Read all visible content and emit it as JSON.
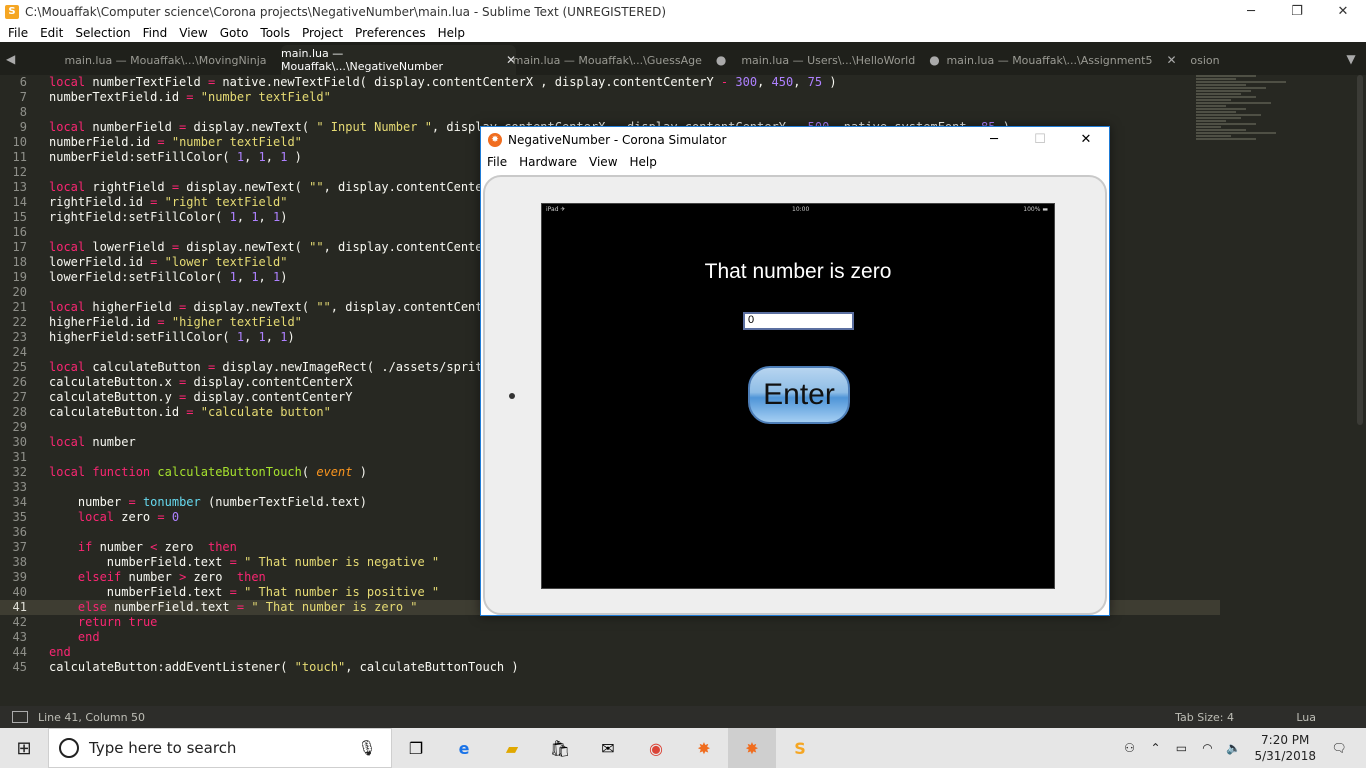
{
  "window": {
    "title": "C:\\Mouaffak\\Computer science\\Corona projects\\NegativeNumber\\main.lua - Sublime Text (UNREGISTERED)"
  },
  "menu": [
    "File",
    "Edit",
    "Selection",
    "Find",
    "View",
    "Goto",
    "Tools",
    "Project",
    "Preferences",
    "Help"
  ],
  "tabs": [
    {
      "label": "main.lua — Mouaffak\\...\\MovingNinja",
      "close": "✕",
      "active": false
    },
    {
      "label": "main.lua — Mouaffak\\...\\NegativeNumber",
      "close": "✕",
      "active": true
    },
    {
      "label": "main.lua — Mouaffak\\...\\GuessAge",
      "close": "●",
      "active": false
    },
    {
      "label": "main.lua — Users\\...\\HelloWorld",
      "close": "●",
      "active": false
    },
    {
      "label": "main.lua — Mouaffak\\...\\Assignment5",
      "close": "✕",
      "active": false
    },
    {
      "label": "osion",
      "close": "",
      "active": false
    }
  ],
  "editor": {
    "current_line": 41,
    "lines": [
      {
        "n": "6",
        "code": "local numberTextField = native.newTextField( display.contentCenterX , display.contentCenterY - 300, 450, 75 )"
      },
      {
        "n": "7",
        "code": "numberTextField.id = \"number textField\""
      },
      {
        "n": "8",
        "code": ""
      },
      {
        "n": "9",
        "code": "local numberField = display.newText( \" Input Number \", display.contentCenterX , display.contentCenterY - 500, native.systemFont, 85 )"
      },
      {
        "n": "10",
        "code": "numberField.id = \"number textField\""
      },
      {
        "n": "11",
        "code": "numberField:setFillColor( 1, 1, 1 )"
      },
      {
        "n": "12",
        "code": ""
      },
      {
        "n": "13",
        "code": "local rightField = display.newText( \"\", display.contentCenter"
      },
      {
        "n": "14",
        "code": "rightField.id = \"right textField\""
      },
      {
        "n": "15",
        "code": "rightField:setFillColor( 1, 1, 1)"
      },
      {
        "n": "16",
        "code": ""
      },
      {
        "n": "17",
        "code": "local lowerField = display.newText( \"\", display.contentCenter"
      },
      {
        "n": "18",
        "code": "lowerField.id = \"lower textField\""
      },
      {
        "n": "19",
        "code": "lowerField:setFillColor( 1, 1, 1)"
      },
      {
        "n": "20",
        "code": ""
      },
      {
        "n": "21",
        "code": "local higherField = display.newText( \"\", display.contentCenter"
      },
      {
        "n": "22",
        "code": "higherField.id = \"higher textField\""
      },
      {
        "n": "23",
        "code": "higherField:setFillColor( 1, 1, 1)"
      },
      {
        "n": "24",
        "code": ""
      },
      {
        "n": "25",
        "code": "local calculateButton = display.newImageRect( \"./assets/sprite"
      },
      {
        "n": "26",
        "code": "calculateButton.x = display.contentCenterX"
      },
      {
        "n": "27",
        "code": "calculateButton.y = display.contentCenterY"
      },
      {
        "n": "28",
        "code": "calculateButton.id = \"calculate button\""
      },
      {
        "n": "29",
        "code": ""
      },
      {
        "n": "30",
        "code": "local number"
      },
      {
        "n": "31",
        "code": ""
      },
      {
        "n": "32",
        "code": "local function calculateButtonTouch( event )"
      },
      {
        "n": "33",
        "code": ""
      },
      {
        "n": "34",
        "code": "    number = tonumber (numberTextField.text)"
      },
      {
        "n": "35",
        "code": "    local zero = 0"
      },
      {
        "n": "36",
        "code": ""
      },
      {
        "n": "37",
        "code": "    if number < zero  then"
      },
      {
        "n": "38",
        "code": "        numberField.text = \" That number is negative \""
      },
      {
        "n": "39",
        "code": "    elseif number > zero  then"
      },
      {
        "n": "40",
        "code": "        numberField.text = \" That number is positive \""
      },
      {
        "n": "41",
        "code": "    else numberField.text = \" That number is zero \""
      },
      {
        "n": "42",
        "code": "    return true"
      },
      {
        "n": "43",
        "code": "    end"
      },
      {
        "n": "44",
        "code": "end"
      },
      {
        "n": "45",
        "code": "calculateButton:addEventListener( \"touch\", calculateButtonTouch )"
      }
    ]
  },
  "statusbar": {
    "position": "Line 41, Column 50",
    "tab_size": "Tab Size: 4",
    "syntax": "Lua"
  },
  "simulator": {
    "title": "NegativeNumber - Corona Simulator",
    "menu": [
      "File",
      "Hardware",
      "View",
      "Help"
    ],
    "status_left": "iPad ✈",
    "status_center": "10:00",
    "status_right": "100% ▬",
    "label": "That number is zero",
    "input_value": "0",
    "button_label": "Enter"
  },
  "taskbar": {
    "search_placeholder": "Type here to search",
    "time": "7:20 PM",
    "date": "5/31/2018"
  },
  "colors": {
    "editor_bg": "#272822",
    "keyword": "#f92672",
    "string": "#e6db74",
    "number": "#ae81ff",
    "function": "#a6e22e",
    "builtin": "#66d9ef",
    "param": "#fd971f"
  }
}
